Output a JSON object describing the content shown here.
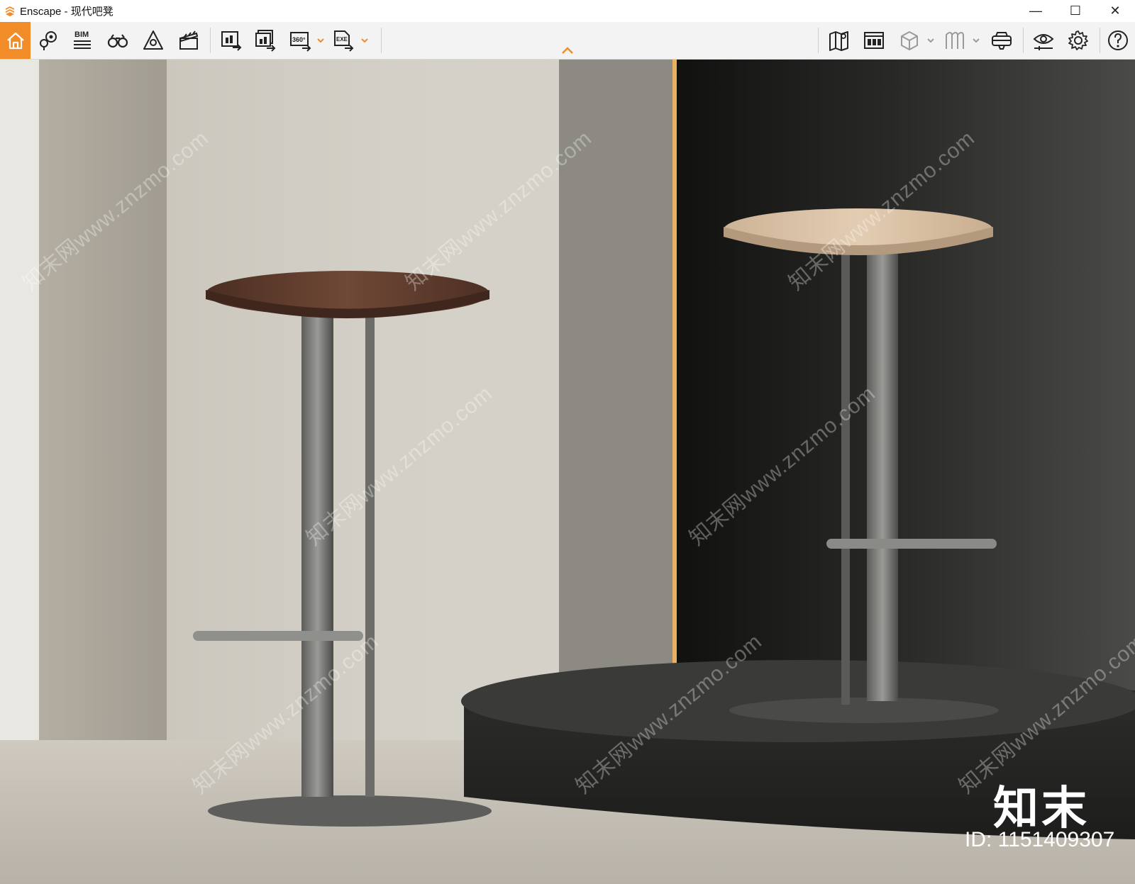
{
  "window": {
    "app_name": "Enscape",
    "separator": " - ",
    "document_title": "现代吧凳",
    "controls": {
      "minimize": "—",
      "maximize": "☐",
      "close": "✕"
    }
  },
  "toolbar": {
    "accent_color": "#f28c28",
    "left_tools": [
      {
        "icon": "home-icon"
      },
      {
        "icon": "map-pin-icon"
      },
      {
        "icon": "bim-icon",
        "label": "BIM"
      },
      {
        "icon": "binoculars-icon"
      },
      {
        "icon": "sun-triangle-icon"
      },
      {
        "icon": "clapperboard-icon"
      },
      {
        "icon": "render-screenshot-icon"
      },
      {
        "icon": "batch-render-icon"
      },
      {
        "icon": "panorama-360-icon",
        "label": "360°"
      },
      {
        "icon": "export-exe-icon",
        "label": "EXE"
      }
    ],
    "right_tools": [
      {
        "icon": "map-icon"
      },
      {
        "icon": "asset-library-icon"
      },
      {
        "icon": "cube-view-icon"
      },
      {
        "icon": "collaborative-annotation-icon"
      },
      {
        "icon": "vr-headset-icon"
      },
      {
        "icon": "visual-settings-eye-icon"
      },
      {
        "icon": "gear-icon"
      },
      {
        "icon": "help-icon"
      }
    ]
  },
  "viewport": {
    "watermark_text": "知末网www.znzmo.com",
    "brand_mark": "知末",
    "asset_id": "ID: 1151409307"
  }
}
